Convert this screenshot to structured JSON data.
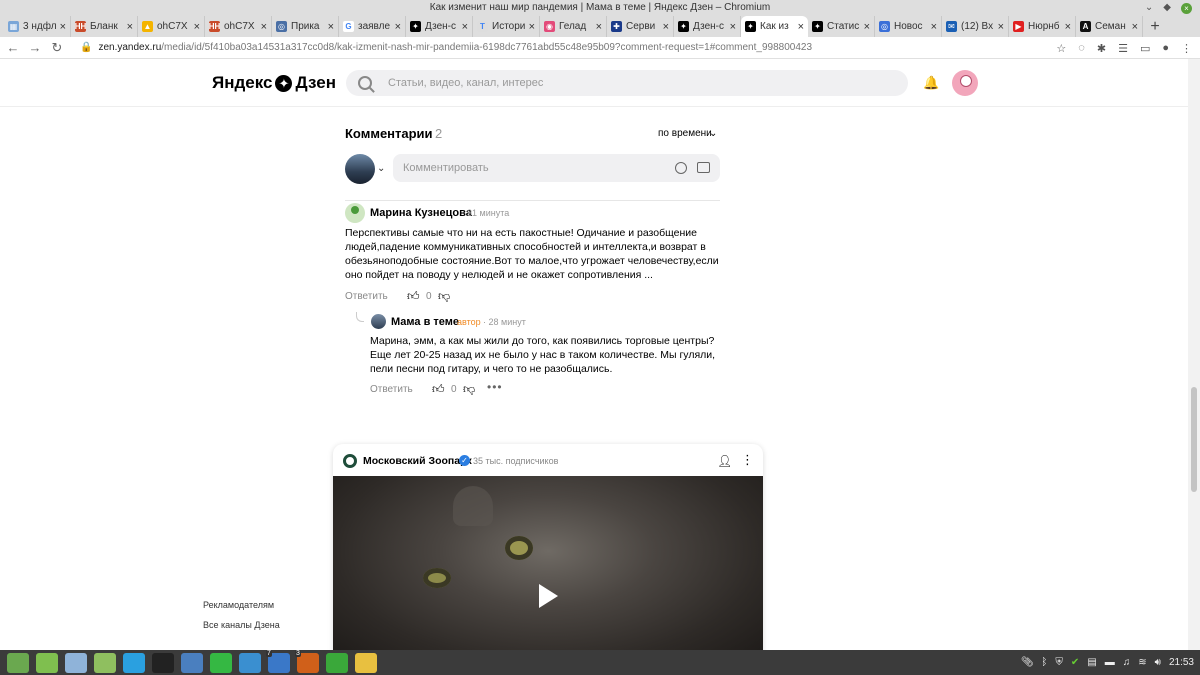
{
  "window": {
    "title": "Как изменит наш мир пандемия | Мама в теме | Яндекс Дзен – Chromium",
    "minimize_icon": "chevron-down-icon",
    "restore_icon": "diamond-icon",
    "close_icon": "close-icon"
  },
  "tabs": [
    {
      "label": "3 ндфл",
      "color": "#7aa6d8",
      "glyph": "▦"
    },
    {
      "label": "Бланк",
      "color": "#c94b2a",
      "glyph": "НН"
    },
    {
      "label": "ohC7X",
      "color": "#f4b400",
      "glyph": "▲"
    },
    {
      "label": "ohC7X",
      "color": "#c94b2a",
      "glyph": "НН"
    },
    {
      "label": "Прика",
      "color": "#4a6fa5",
      "glyph": "◎"
    },
    {
      "label": "заявле",
      "color": "#ffffff",
      "glyph": "G"
    },
    {
      "label": "Дзен-с",
      "color": "#000000",
      "glyph": "✦"
    },
    {
      "label": "Истори",
      "color": "#dddddd",
      "glyph": "T"
    },
    {
      "label": "Гелад",
      "color": "#e34b7a",
      "glyph": "◉"
    },
    {
      "label": "Серви",
      "color": "#1a3a8a",
      "glyph": "✚"
    },
    {
      "label": "Дзен-с",
      "color": "#000000",
      "glyph": "✦"
    },
    {
      "label": "Как из",
      "color": "#000000",
      "glyph": "✦",
      "active": true
    },
    {
      "label": "Статис",
      "color": "#000000",
      "glyph": "✦"
    },
    {
      "label": "Новос",
      "color": "#3a6fd8",
      "glyph": "◎"
    },
    {
      "label": "(12) Вх",
      "color": "#1a5fb4",
      "glyph": "✉"
    },
    {
      "label": "Нюрнб",
      "color": "#e02020",
      "glyph": "▶"
    },
    {
      "label": "Семан",
      "color": "#111111",
      "glyph": "A"
    }
  ],
  "tab_close": "×",
  "new_tab": "+",
  "address": {
    "host": "zen.yandex.ru",
    "path": "/media/id/5f410ba03a14531a317cc0d8/kak-izmenit-nash-mir-pandemiia-6198dc7761abd55c48e95b09?comment-request=1#comment_998800423"
  },
  "header": {
    "logo": "Яндекс",
    "logo_part2": "Дзен",
    "search_placeholder": "Статьи, видео, канал, интерес"
  },
  "comments": {
    "title": "Комментарии",
    "count": "2",
    "sort": "по времени",
    "input_placeholder": "Комментировать",
    "items": [
      {
        "author": "Марина Кузнецова",
        "time": "31 минута",
        "text": "Перспективы самые что ни на есть пакостные! Одичание и разобщение людей,падение коммуникативных способностей и интеллекта,и возврат в обезьяноподобные состояние.Вот то малое,что угрожает человечеству,если оно пойдет на поводу у нелюдей и не окажет сопротивления ...",
        "reply_label": "Ответить",
        "likes": "0"
      },
      {
        "author": "Мама в теме",
        "badge": "автор",
        "time": "· 28 минут",
        "text": "Марина, эмм, а как мы жили до того, как появились торговые центры? Еще лет 20-25 назад их не было у нас в таком количестве. Мы гуляли, пели песни под гитару, и чего то не разобщались.",
        "reply_label": "Ответить",
        "likes": "0",
        "more": "•••"
      }
    ]
  },
  "card": {
    "channel": "Московский Зоопарк",
    "subs": "35 тыс. подписчиков"
  },
  "footer": {
    "link1": "Рекламодателям",
    "link2": "Все каналы Дзена"
  },
  "taskbar": {
    "items": [
      {
        "name": "mint-menu",
        "color": "#6aa84f"
      },
      {
        "name": "files",
        "color": "#7fbf4f"
      },
      {
        "name": "chromium",
        "color": "#8fb3d9"
      },
      {
        "name": "folder",
        "color": "#8fbf5f"
      },
      {
        "name": "skype",
        "color": "#2aa0e0"
      },
      {
        "name": "terminal",
        "color": "#222222"
      },
      {
        "name": "image-viewer",
        "color": "#4a7fbf"
      },
      {
        "name": "whatsapp",
        "color": "#35b843"
      },
      {
        "name": "monitor",
        "color": "#3a8fd0"
      },
      {
        "name": "writer",
        "color": "#3a78c8",
        "badge": "7"
      },
      {
        "name": "impress",
        "color": "#d0601a",
        "badge": "3"
      },
      {
        "name": "calc",
        "color": "#3aa83a"
      },
      {
        "name": "editor",
        "color": "#e8c040"
      }
    ],
    "clock": "21:53"
  }
}
